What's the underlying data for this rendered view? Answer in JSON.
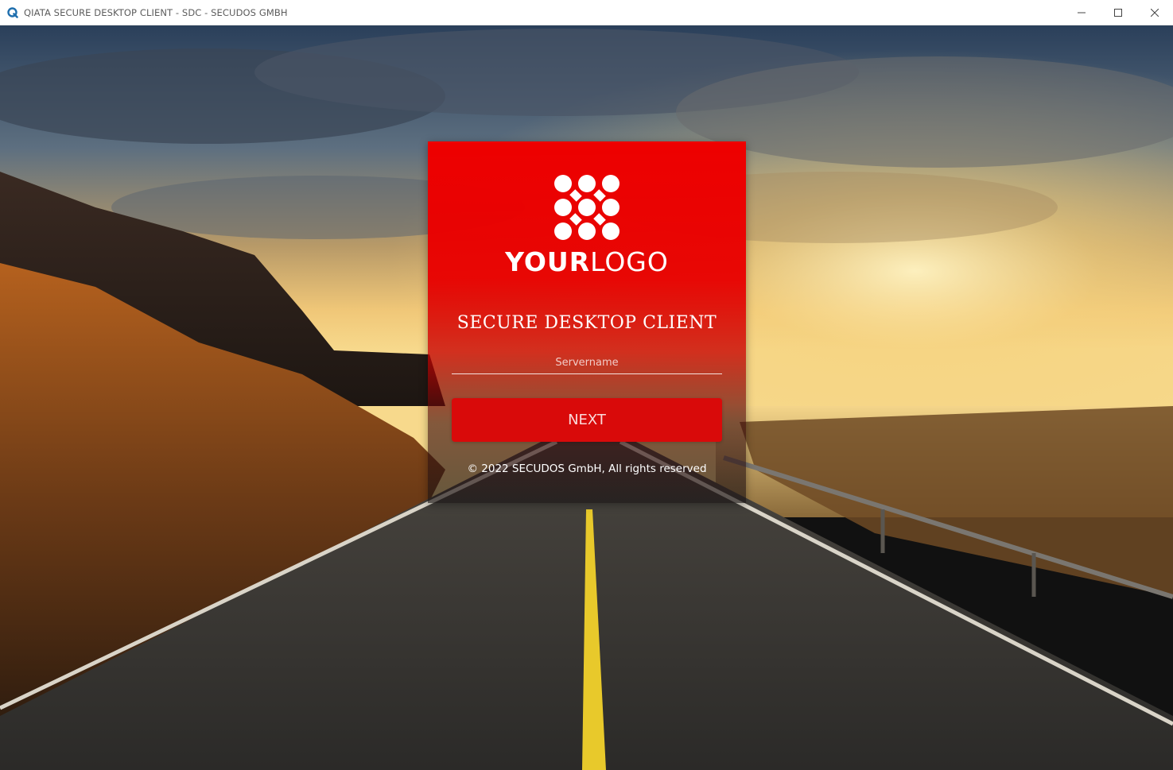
{
  "window": {
    "title": "QIATA SECURE DESKTOP CLIENT - SDC - SECUDOS GMBH",
    "app_icon": "qiata-q-icon",
    "controls": [
      "minimize-icon",
      "maximize-icon",
      "close-icon"
    ]
  },
  "login": {
    "logo": {
      "bold_part": "YOUR",
      "light_part": "LOGO",
      "icon": "dot-pattern-logo-icon"
    },
    "title": "SECURE DESKTOP CLIENT",
    "server_field": {
      "placeholder": "Servername",
      "value": ""
    },
    "next_label": "NEXT",
    "copyright": "© 2022 SECUDOS GmbH, All rights reserved"
  },
  "colors": {
    "panel_red": "#ee0000",
    "button_red": "#d90a0a",
    "titlebar_bg": "#ffffff",
    "app_icon_blue": "#1f6fae"
  }
}
